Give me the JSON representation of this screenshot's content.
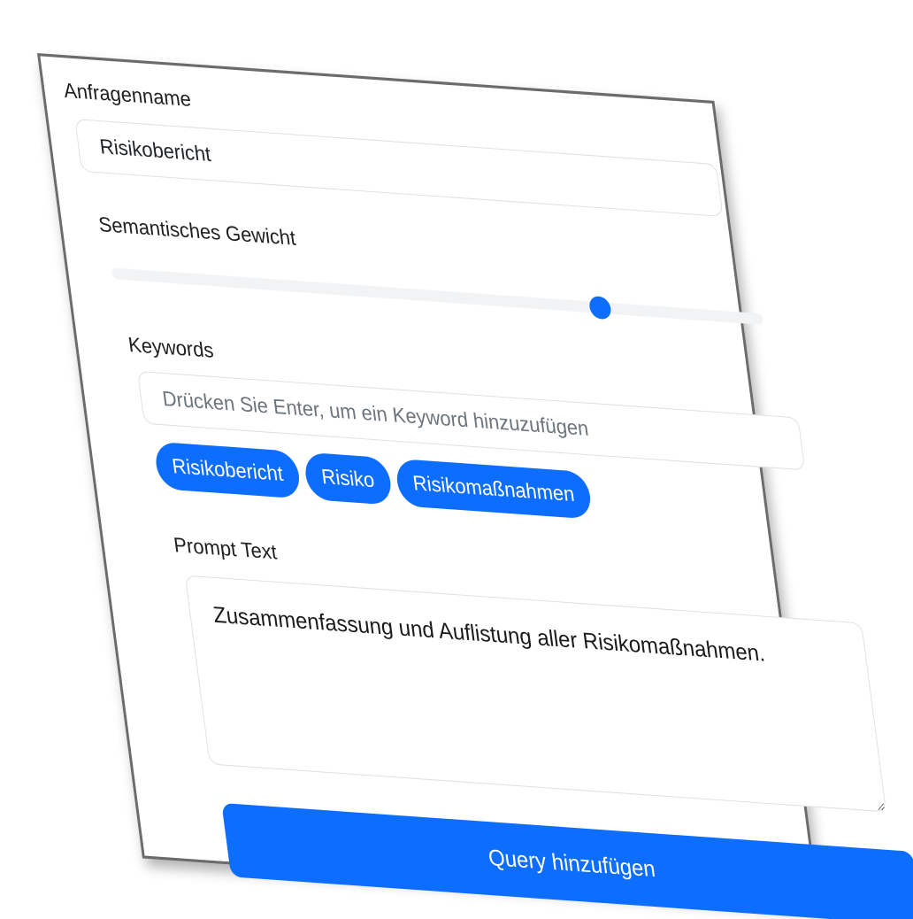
{
  "form": {
    "query_name": {
      "label": "Anfragenname",
      "value": "Risikobericht"
    },
    "semantic_weight": {
      "label": "Semantisches Gewicht",
      "value": 0.75
    },
    "keywords": {
      "label": "Keywords",
      "placeholder": "Drücken Sie Enter, um ein Keyword hinzuzufügen",
      "items": [
        "Risikobericht",
        "Risiko",
        "Risikomaßnahmen"
      ]
    },
    "prompt": {
      "label": "Prompt Text",
      "value": "Zusammenfassung und Auflistung aller Risikomaßnahmen."
    },
    "submit_label": "Query hinzufügen"
  },
  "colors": {
    "accent": "#0d6efd",
    "border": "#dee2e6",
    "track": "#f1f3f5"
  }
}
